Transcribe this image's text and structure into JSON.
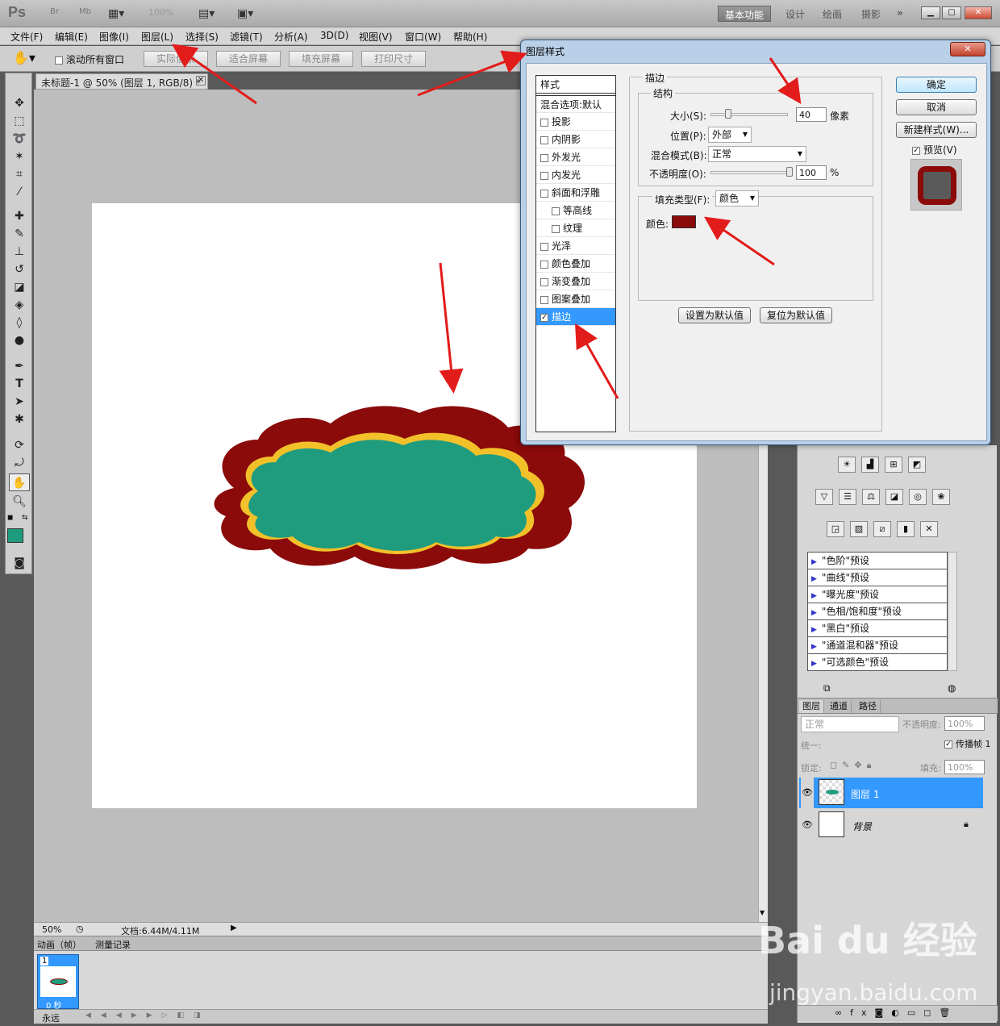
{
  "app": {
    "logo": "Ps",
    "zoom_combo": "100%",
    "workspaces": [
      "基本功能",
      "设计",
      "绘画",
      "摄影"
    ],
    "overflow": "»"
  },
  "menu": [
    "文件(F)",
    "编辑(E)",
    "图像(I)",
    "图层(L)",
    "选择(S)",
    "滤镜(T)",
    "分析(A)",
    "3D(D)",
    "视图(V)",
    "窗口(W)",
    "帮助(H)"
  ],
  "options": {
    "scroll_all": "滚动所有窗口",
    "buttons": [
      "实际像素",
      "适合屏幕",
      "填充屏幕",
      "打印尺寸"
    ]
  },
  "document": {
    "tab_title": "未标题-1 @ 50% (图层 1, RGB/8) *",
    "zoom": "50%",
    "doc_info": "文档:6.44M/4.11M"
  },
  "animation": {
    "tabs": [
      "动画（帧）",
      "测量记录"
    ],
    "frame_number": "1",
    "frame_delay": "0 秒",
    "loop": "永远"
  },
  "dialog": {
    "title": "图层样式",
    "list_header": "样式",
    "items": [
      {
        "label": "混合选项:默认",
        "checkbox": false,
        "checked": false
      },
      {
        "label": "投影",
        "checkbox": true,
        "checked": false
      },
      {
        "label": "内阴影",
        "checkbox": true,
        "checked": false
      },
      {
        "label": "外发光",
        "checkbox": true,
        "checked": false
      },
      {
        "label": "内发光",
        "checkbox": true,
        "checked": false
      },
      {
        "label": "斜面和浮雕",
        "checkbox": true,
        "checked": false
      },
      {
        "label": "等高线",
        "checkbox": true,
        "checked": false
      },
      {
        "label": "纹理",
        "checkbox": true,
        "checked": false
      },
      {
        "label": "光泽",
        "checkbox": true,
        "checked": false
      },
      {
        "label": "颜色叠加",
        "checkbox": true,
        "checked": false
      },
      {
        "label": "渐变叠加",
        "checkbox": true,
        "checked": false
      },
      {
        "label": "图案叠加",
        "checkbox": true,
        "checked": false
      },
      {
        "label": "描边",
        "checkbox": true,
        "checked": true
      }
    ],
    "stroke": {
      "group_title": "描边",
      "structure_title": "结构",
      "size_label": "大小(S):",
      "size_value": "40",
      "size_unit": "像素",
      "position_label": "位置(P):",
      "position_value": "外部",
      "blend_label": "混合模式(B):",
      "blend_value": "正常",
      "opacity_label": "不透明度(O):",
      "opacity_value": "100",
      "opacity_unit": "%",
      "fill_type_label": "填充类型(F):",
      "fill_type_value": "颜色",
      "color_label": "颜色:",
      "color_hex": "#8b0a0a",
      "set_default": "设置为默认值",
      "reset_default": "复位为默认值"
    },
    "buttons": {
      "ok": "确定",
      "cancel": "取消",
      "new_style": "新建样式(W)...",
      "preview": "预览(V)"
    }
  },
  "adjustments": {
    "presets": [
      "\"色阶\"预设",
      "\"曲线\"预设",
      "\"曝光度\"预设",
      "\"色相/饱和度\"预设",
      "\"黑白\"预设",
      "\"通道混和器\"预设",
      "\"可选颜色\"预设"
    ]
  },
  "layers_panel": {
    "tabs": [
      "图层",
      "通道",
      "路径"
    ],
    "blend": "正常",
    "opacity_label": "不透明度:",
    "opacity_value": "100%",
    "unify_label": "统一:",
    "propagate": "传播帧 1",
    "lock_label": "锁定:",
    "fill_label": "填充:",
    "fill_value": "100%",
    "layers": [
      {
        "name": "图层 1",
        "selected": true
      },
      {
        "name": "背景",
        "selected": false
      }
    ]
  },
  "shape_colors": {
    "fill": "#1f9c7e",
    "inner_stroke": "#f2c12a",
    "outer_stroke": "#8b0a0a"
  },
  "watermark": {
    "brand": "Bai du 经验",
    "url": "jingyan.baidu.com"
  }
}
